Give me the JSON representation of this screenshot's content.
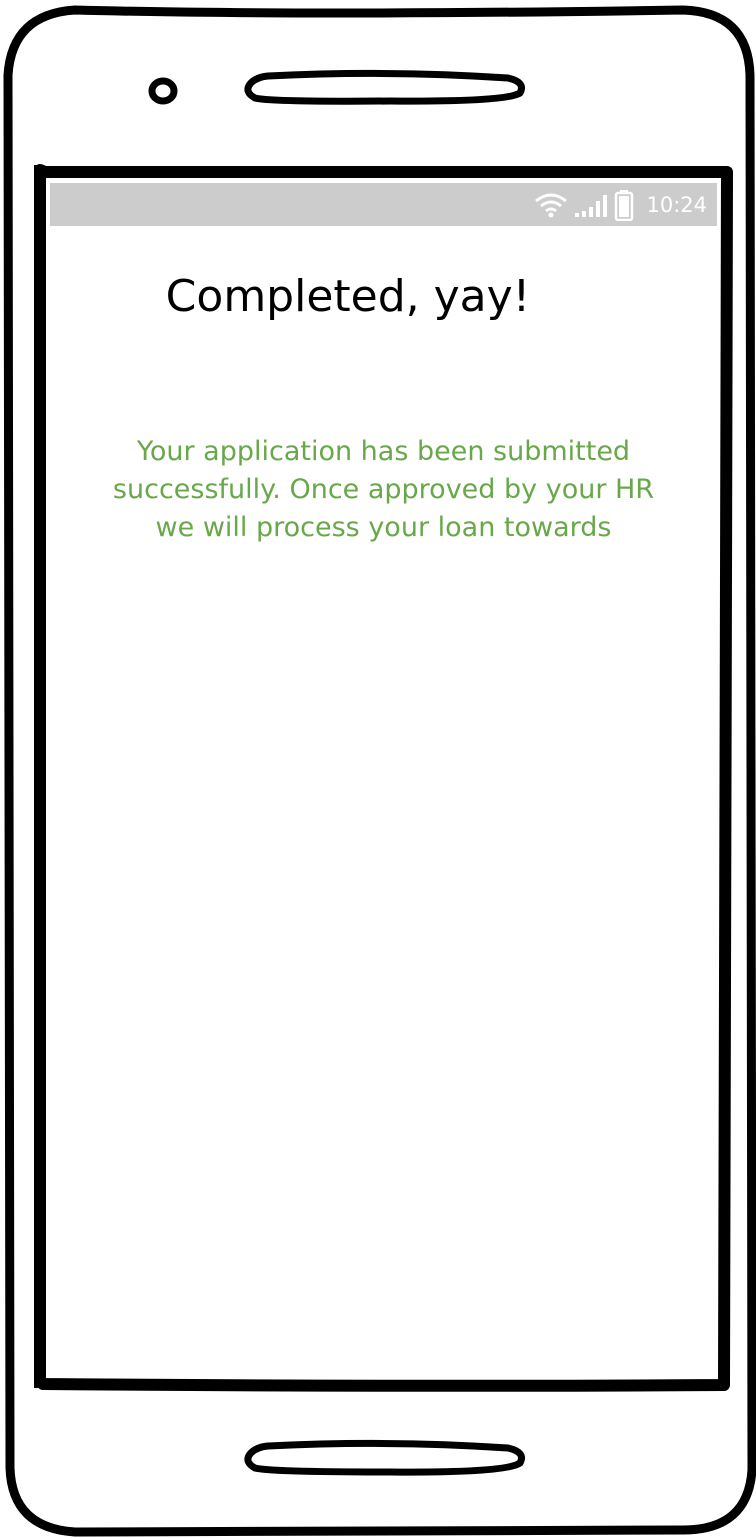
{
  "status_bar": {
    "time": "10:24",
    "icons": [
      "wifi-icon",
      "signal-icon",
      "battery-icon"
    ]
  },
  "page": {
    "title": "Completed, yay!",
    "message": "Your application has been submitted successfully. Once approved by your HR we will process your loan towards"
  },
  "colors": {
    "message": "#68a84a",
    "status_bar": "#cccccc",
    "frame": "#000000"
  }
}
